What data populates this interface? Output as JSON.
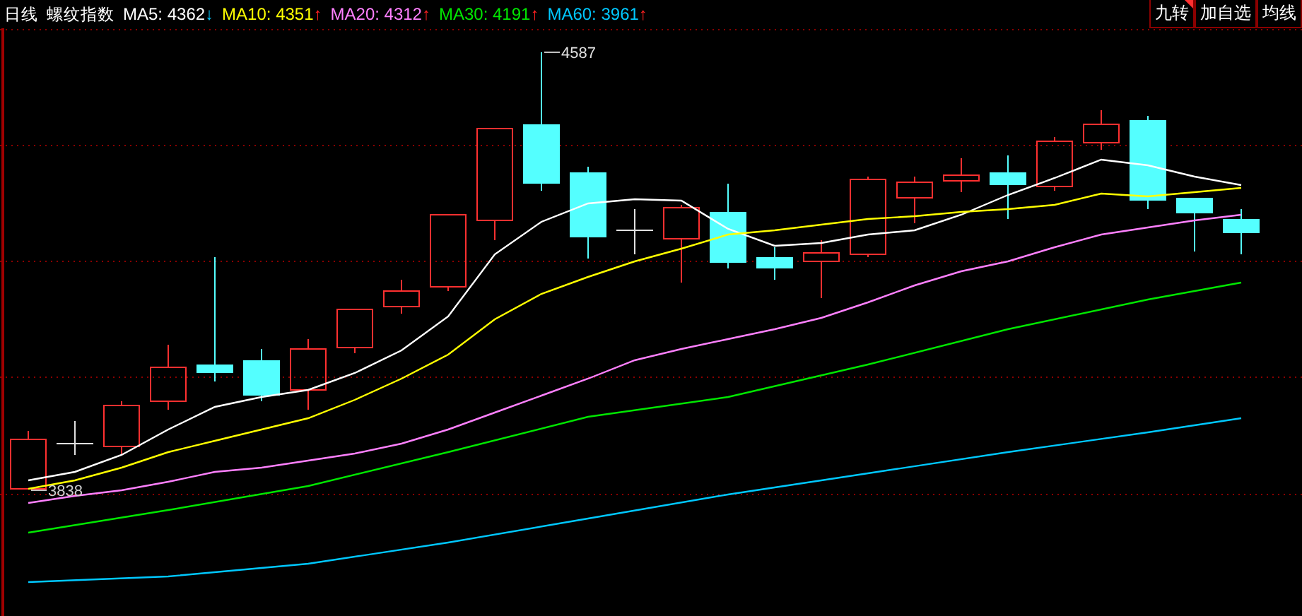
{
  "header": {
    "period": "日线",
    "title": "螺纹指数",
    "moving_averages": [
      {
        "text": "MA5: 4362",
        "rising": false,
        "arrow": "↓",
        "color": "#ffffff"
      },
      {
        "text": "MA10: 4351",
        "rising": true,
        "arrow": "↑",
        "color": "#ffff00"
      },
      {
        "text": "MA20: 4312",
        "rising": true,
        "arrow": "↑",
        "color": "#ff80ff"
      },
      {
        "text": "MA30: 4191",
        "rising": true,
        "arrow": "↑",
        "color": "#00e600"
      },
      {
        "text": "MA60: 3961",
        "rising": true,
        "arrow": "↑",
        "color": "#00c8ff"
      }
    ]
  },
  "buttons": [
    {
      "label": "九转",
      "flagged": true
    },
    {
      "label": "加自选",
      "flagged": false
    },
    {
      "label": "均线",
      "flagged": false
    }
  ],
  "chart": {
    "high_label": "4587",
    "low_label": "3838"
  }
}
